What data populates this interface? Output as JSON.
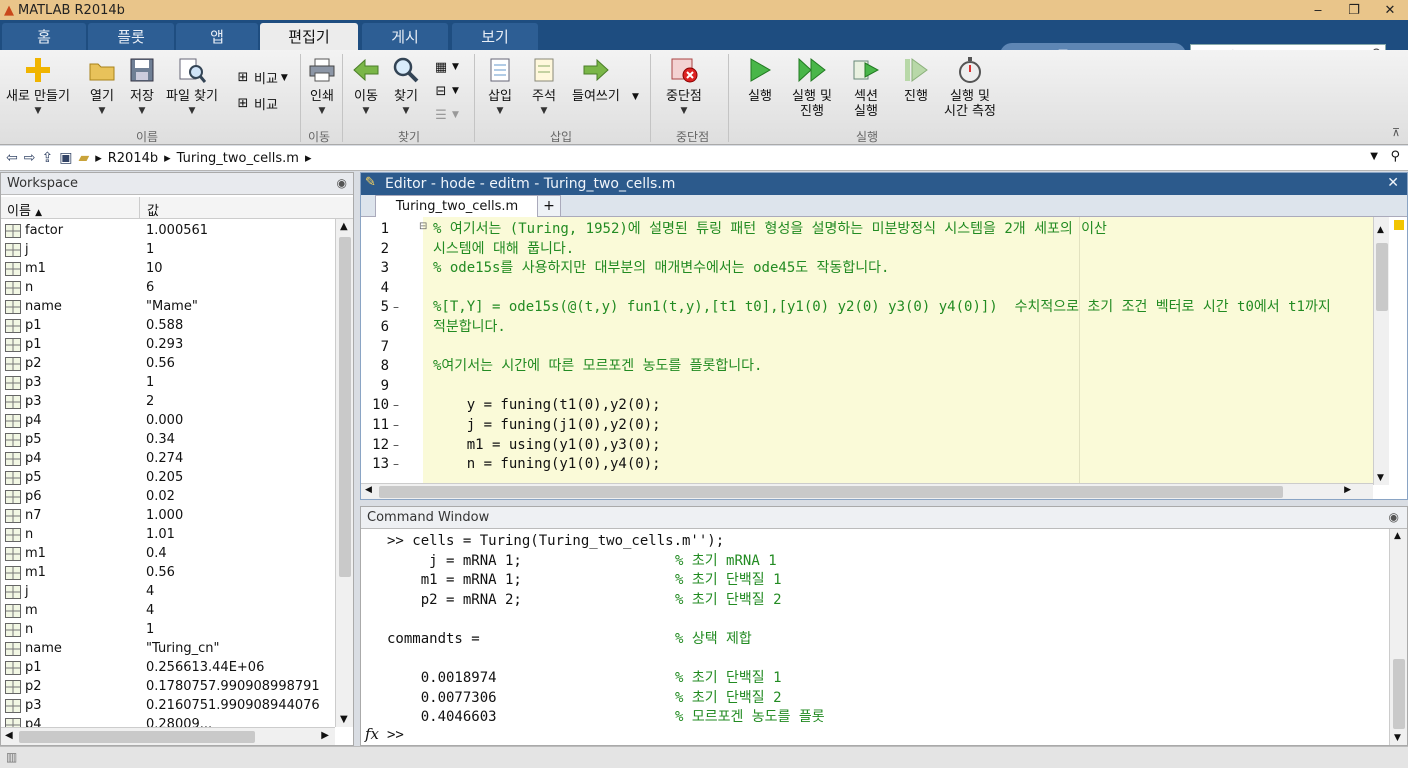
{
  "app": {
    "title": "MATLAB R2014b"
  },
  "window_controls": {
    "minimize": "‒",
    "restore": "❐",
    "close": "✕"
  },
  "tabs": [
    {
      "label": "홈"
    },
    {
      "label": "플롯"
    },
    {
      "label": "앱"
    },
    {
      "label": "편집기"
    },
    {
      "label": "게시"
    },
    {
      "label": "보기"
    }
  ],
  "search": {
    "placeholder": "문서 검색"
  },
  "ribbon": {
    "new_label": "새로 만들기",
    "open_label": "열기",
    "save_label": "저장",
    "find_files_label": "파일 찾기",
    "compare1_label": "비교",
    "compare2_label": "비교",
    "print_label": "인쇄",
    "goto_label": "이동",
    "find_label": "찾기",
    "insert_label": "삽입",
    "comment_label": "주석",
    "indent_label": "들여쓰기",
    "breakpoints_label": "중단점",
    "run_label": "실행",
    "run_advance_label1": "실행 및",
    "run_advance_label2": "진행",
    "run_section_label1": "섹션",
    "run_section_label2": "실행",
    "advance_label": "진행",
    "run_time_label1": "실행 및",
    "run_time_label2": "시간 측정",
    "groups": {
      "file": "이름",
      "navigate": "이동",
      "edit_find": "찾기",
      "edit": "삽입",
      "breakpoints": "중단점",
      "run": "실행"
    }
  },
  "address": {
    "crumb1": "R2014b",
    "crumb2": "Turing_two_cells.m"
  },
  "workspace": {
    "title": "Workspace",
    "col_name": "이름",
    "col_value": "값",
    "rows": [
      {
        "name": "factor",
        "value": "1.000561"
      },
      {
        "name": "j",
        "value": "1"
      },
      {
        "name": "m1",
        "value": "10"
      },
      {
        "name": "n",
        "value": "6"
      },
      {
        "name": "name",
        "value": "\"Mame\""
      },
      {
        "name": "p1",
        "value": "0.588"
      },
      {
        "name": "p1",
        "value": "0.293"
      },
      {
        "name": "p2",
        "value": "0.56"
      },
      {
        "name": "p3",
        "value": "1"
      },
      {
        "name": "p3",
        "value": "2"
      },
      {
        "name": "p4",
        "value": "0.000"
      },
      {
        "name": "p5",
        "value": "0.34"
      },
      {
        "name": "p4",
        "value": "0.274"
      },
      {
        "name": "p5",
        "value": "0.205"
      },
      {
        "name": "p6",
        "value": "0.02"
      },
      {
        "name": "n7",
        "value": "1.000"
      },
      {
        "name": "n",
        "value": "1.01"
      },
      {
        "name": "m1",
        "value": "0.4"
      },
      {
        "name": "m1",
        "value": "0.56"
      },
      {
        "name": "j",
        "value": "4"
      },
      {
        "name": "m",
        "value": "4"
      },
      {
        "name": "n",
        "value": "1"
      },
      {
        "name": "name",
        "value": "\"Turing_cn\""
      },
      {
        "name": "p1",
        "value": "0.256613.44E+06"
      },
      {
        "name": "p2",
        "value": "0.1780757.990908998791"
      },
      {
        "name": "p3",
        "value": "0.2160751.990908944076"
      },
      {
        "name": "p4",
        "value": "0.28009..."
      }
    ]
  },
  "editor": {
    "title": "Editor - hode - editm - Turing_two_cells.m",
    "tab_label": "Turing_two_cells.m",
    "add_tab": "+",
    "lines": [
      {
        "num": "1",
        "text": "% 여기서는 (Turing, 1952)에 설명된 튜링 패턴 형성을 설명하는 미분방정식 시스템을 2개 세포의 이산"
      },
      {
        "num": "2",
        "text": "시스템에 대해 풉니다."
      },
      {
        "num": "3",
        "text": "% ode15s를 사용하지만 대부분의 매개변수에서는 ode45도 작동합니다."
      },
      {
        "num": "4",
        "text": ""
      },
      {
        "num": "5",
        "text": "%[T,Y] = ode15s(@(t,y) fun1(t,y),[t1 t0],[y1(0) y2(0) y3(0) y4(0)])  수치적으로 초기 조건 벡터로 시간 t0에서 t1까지"
      },
      {
        "num": "6",
        "text": "적분합니다."
      },
      {
        "num": "7",
        "text": ""
      },
      {
        "num": "8",
        "text": "%여기서는 시간에 따른 모르포겐 농도를 플롯합니다."
      },
      {
        "num": "9",
        "text": ""
      },
      {
        "num": "10",
        "text": "    y = funing(t1(0),y2(0);"
      },
      {
        "num": "11",
        "text": "    j = funing(j1(0),y2(0);"
      },
      {
        "num": "12",
        "text": "    m1 = using(y1(0),y3(0);"
      },
      {
        "num": "13",
        "text": "    n = funing(y1(0),y4(0);"
      }
    ]
  },
  "command": {
    "title": "Command Window",
    "lines": [
      {
        "code": ">> cells = Turing(Turing_two_cells.m'');",
        "comment": ""
      },
      {
        "code": "     j = mRNA 1;",
        "comment": "% 초기 mRNA 1"
      },
      {
        "code": "    m1 = mRNA 1;",
        "comment": "% 초기 단백질 1"
      },
      {
        "code": "    p2 = mRNA 2;",
        "comment": "% 초기 단백질 2"
      },
      {
        "code": "",
        "comment": ""
      },
      {
        "code": "commandts =",
        "comment": "% 상택 제합"
      },
      {
        "code": "",
        "comment": ""
      },
      {
        "code": "    0.0018974",
        "comment": "% 초기 단백질 1"
      },
      {
        "code": "    0.0077306",
        "comment": "% 초기 단백질 2"
      },
      {
        "code": "    0.4046603",
        "comment": "% 모르포겐 농도를 플롯"
      }
    ],
    "fx": "fx",
    "prompt": ">>"
  }
}
